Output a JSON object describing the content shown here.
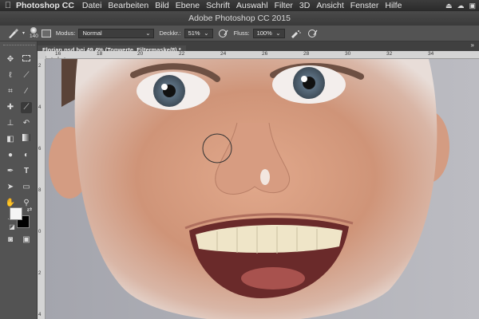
{
  "menubar": {
    "apple": "",
    "app_name": "Photoshop CC",
    "items": [
      "Datei",
      "Bearbeiten",
      "Bild",
      "Ebene",
      "Schrift",
      "Auswahl",
      "Filter",
      "3D",
      "Ansicht",
      "Fenster",
      "Hilfe"
    ]
  },
  "titlebar": {
    "title": "Adobe Photoshop CC 2015"
  },
  "options": {
    "brush_size": "140",
    "mode_label": "Modus:",
    "mode_value": "Normal",
    "opacity_label": "Deckkr.:",
    "opacity_value": "51%",
    "flow_label": "Fluss:",
    "flow_value": "100%"
  },
  "document": {
    "tab_title": "Florian.psd bei 49,4% (Tonwerte, Filtermaske/8) *"
  },
  "ruler": {
    "h_labels": [
      "16",
      "18",
      "20",
      "22",
      "24",
      "26",
      "28",
      "30",
      "32",
      "34"
    ],
    "v_labels": [
      "2",
      "4",
      "6",
      "8",
      "0",
      "2",
      "4"
    ]
  },
  "colors": {
    "foreground": "#f5f5f5",
    "background": "#000000",
    "canvas_backdrop": "#9e9fa7"
  }
}
